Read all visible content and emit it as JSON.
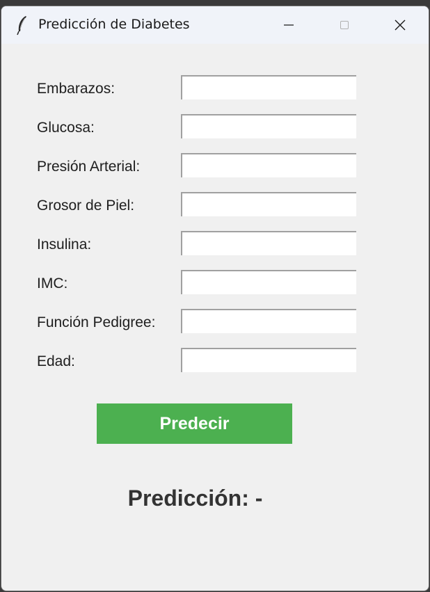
{
  "window": {
    "title": "Predicción de Diabetes",
    "controls": {
      "minimize": "minimize-icon",
      "maximize": "maximize-icon",
      "close": "close-icon"
    }
  },
  "form": {
    "fields": [
      {
        "label": "Embarazos:",
        "value": ""
      },
      {
        "label": "Glucosa:",
        "value": ""
      },
      {
        "label": "Presión Arterial:",
        "value": ""
      },
      {
        "label": "Grosor de Piel:",
        "value": ""
      },
      {
        "label": "Insulina:",
        "value": ""
      },
      {
        "label": "IMC:",
        "value": ""
      },
      {
        "label": "Función Pedigree:",
        "value": ""
      },
      {
        "label": "Edad:",
        "value": ""
      }
    ],
    "submit_label": "Predecir"
  },
  "result": {
    "text": "Predicción: -"
  },
  "colors": {
    "button_bg": "#4cb050",
    "button_text": "#ffffff",
    "window_bg": "#f0f0f0",
    "result_text": "#333333"
  }
}
